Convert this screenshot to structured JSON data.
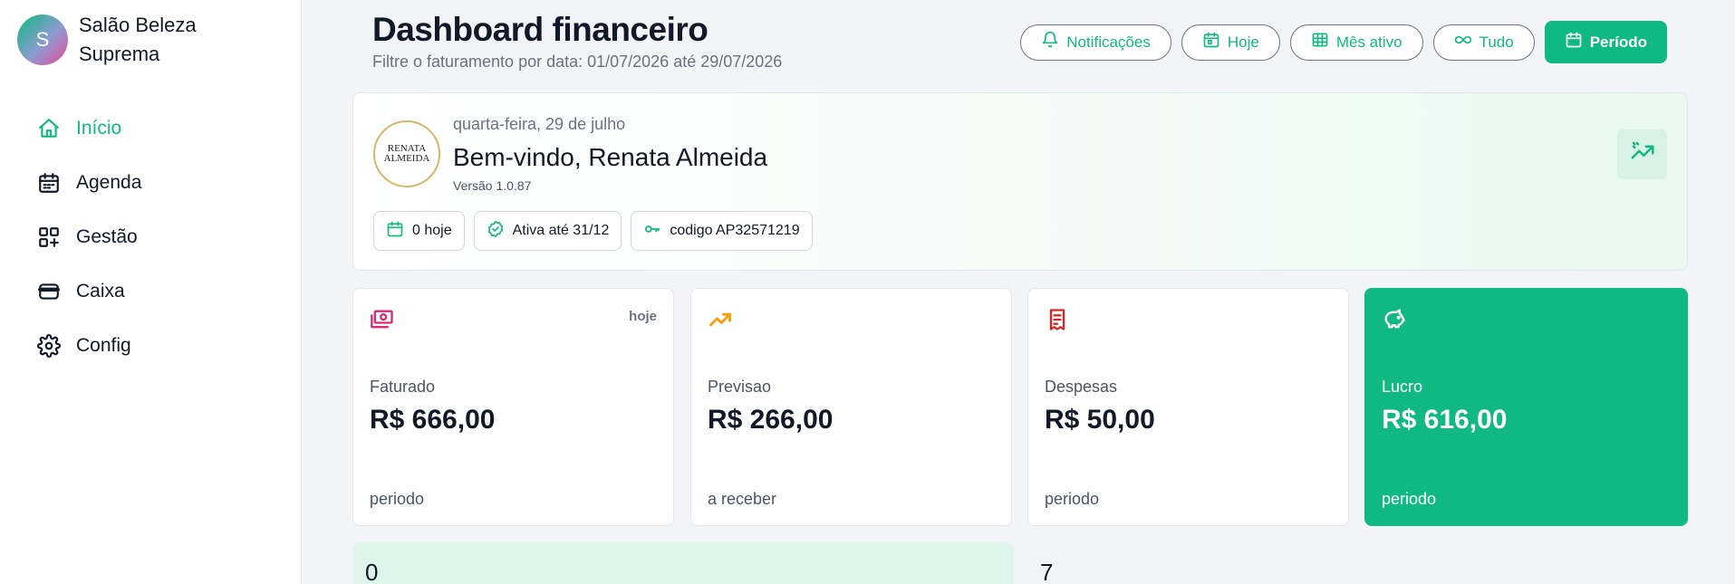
{
  "brand": {
    "initial": "S",
    "name": "Salão Beleza Suprema"
  },
  "nav": [
    {
      "label": "Início",
      "icon": "home-icon",
      "active": true
    },
    {
      "label": "Agenda",
      "icon": "calendar-icon"
    },
    {
      "label": "Gestão",
      "icon": "grid-plus-icon"
    },
    {
      "label": "Caixa",
      "icon": "wallet-icon"
    },
    {
      "label": "Config",
      "icon": "gear-icon"
    }
  ],
  "header": {
    "title": "Dashboard financeiro",
    "subtitle": "Filtre o faturamento por data: 01/07/2026 até 29/07/2026"
  },
  "filters": {
    "notifications": "Notificações",
    "today": "Hoje",
    "active_month": "Mês ativo",
    "all": "Tudo",
    "period": "Período"
  },
  "welcome": {
    "logo_line1": "RENATA",
    "logo_line2": "ALMEIDA",
    "date": "quarta-feira, 29 de julho",
    "greeting": "Bem-vindo, Renata Almeida",
    "version": "Versão 1.0.87",
    "chips": {
      "today": "0 hoje",
      "active": "Ativa até 31/12",
      "code": "codigo AP32571219"
    }
  },
  "stats": {
    "faturado": {
      "tag": "hoje",
      "label": "Faturado",
      "value": "R$ 666,00",
      "foot": "periodo"
    },
    "previsao": {
      "label": "Previsao",
      "value": "R$ 266,00",
      "foot": "a receber"
    },
    "despesas": {
      "label": "Despesas",
      "value": "R$ 50,00",
      "foot": "periodo"
    },
    "lucro": {
      "label": "Lucro",
      "value": "R$ 616,00",
      "foot": "periodo"
    }
  },
  "bottom": {
    "left_value": "0",
    "right_value": "7"
  },
  "colors": {
    "accent": "#10b981",
    "pink": "#db2777",
    "orange": "#f59e0b",
    "red": "#dc2626"
  }
}
